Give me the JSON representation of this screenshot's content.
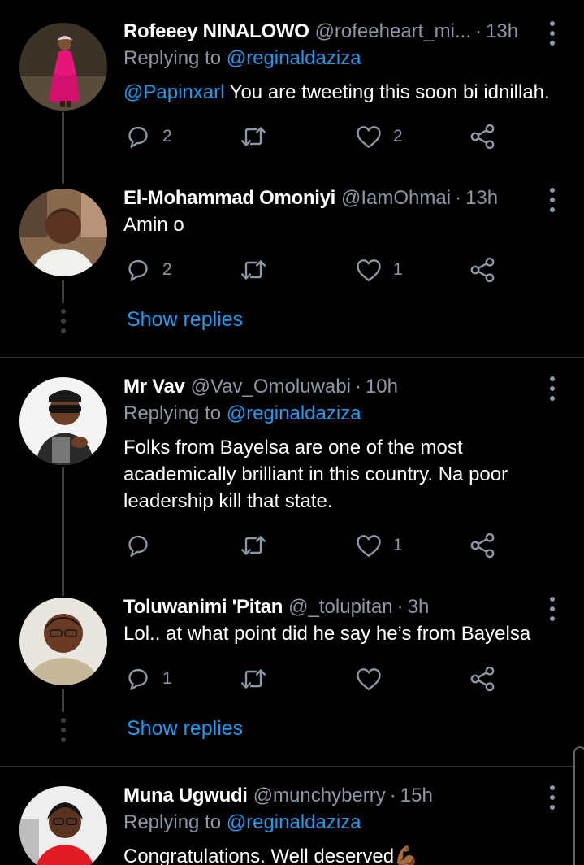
{
  "tweets": [
    {
      "name": "Rofeeey NINALOWO",
      "handle": "@rofeeheart_mi...",
      "time": "13h",
      "replying_prefix": "Replying to",
      "replying_to": "@reginaldaziza",
      "mention": "@Papinxarl",
      "text": " You are tweeting this soon bi idnillah.",
      "replies": "2",
      "retweets": "",
      "likes": "2"
    },
    {
      "name": "El-Mohammad Omoniyi",
      "handle": "@IamOhmai",
      "time": "13h",
      "text": "Amin o",
      "replies": "2",
      "retweets": "",
      "likes": "1"
    },
    {
      "name": "Mr Vav",
      "handle": "@Vav_Omoluwabi",
      "time": "10h",
      "replying_prefix": "Replying to",
      "replying_to": "@reginaldaziza",
      "text": "Folks from Bayelsa are one of the most academically brilliant in this country. Na poor leadership kill that state.",
      "replies": "",
      "retweets": "",
      "likes": "1"
    },
    {
      "name": "Toluwanimi 'Pitan",
      "handle": "@_tolupitan",
      "time": "3h",
      "text": "Lol.. at what point did he say he’s from Bayelsa",
      "replies": "1",
      "retweets": "",
      "likes": ""
    },
    {
      "name": "Muna Ugwudi",
      "handle": "@munchyberry",
      "time": "15h",
      "replying_prefix": "Replying to",
      "replying_to": "@reginaldaziza",
      "text": "Congratulations. Well deserved",
      "emoji": "💪🏾"
    }
  ],
  "show_replies_label": "Show replies",
  "dot_separator": "·",
  "icons": {
    "reply": "reply-icon",
    "retweet": "retweet-icon",
    "like": "heart-icon",
    "share": "share-icon",
    "more": "more-vertical-icon"
  },
  "colors": {
    "background": "#000000",
    "link": "#1d9bf0",
    "secondary_text": "#8b98a5",
    "thread_line": "#3a3f44"
  }
}
